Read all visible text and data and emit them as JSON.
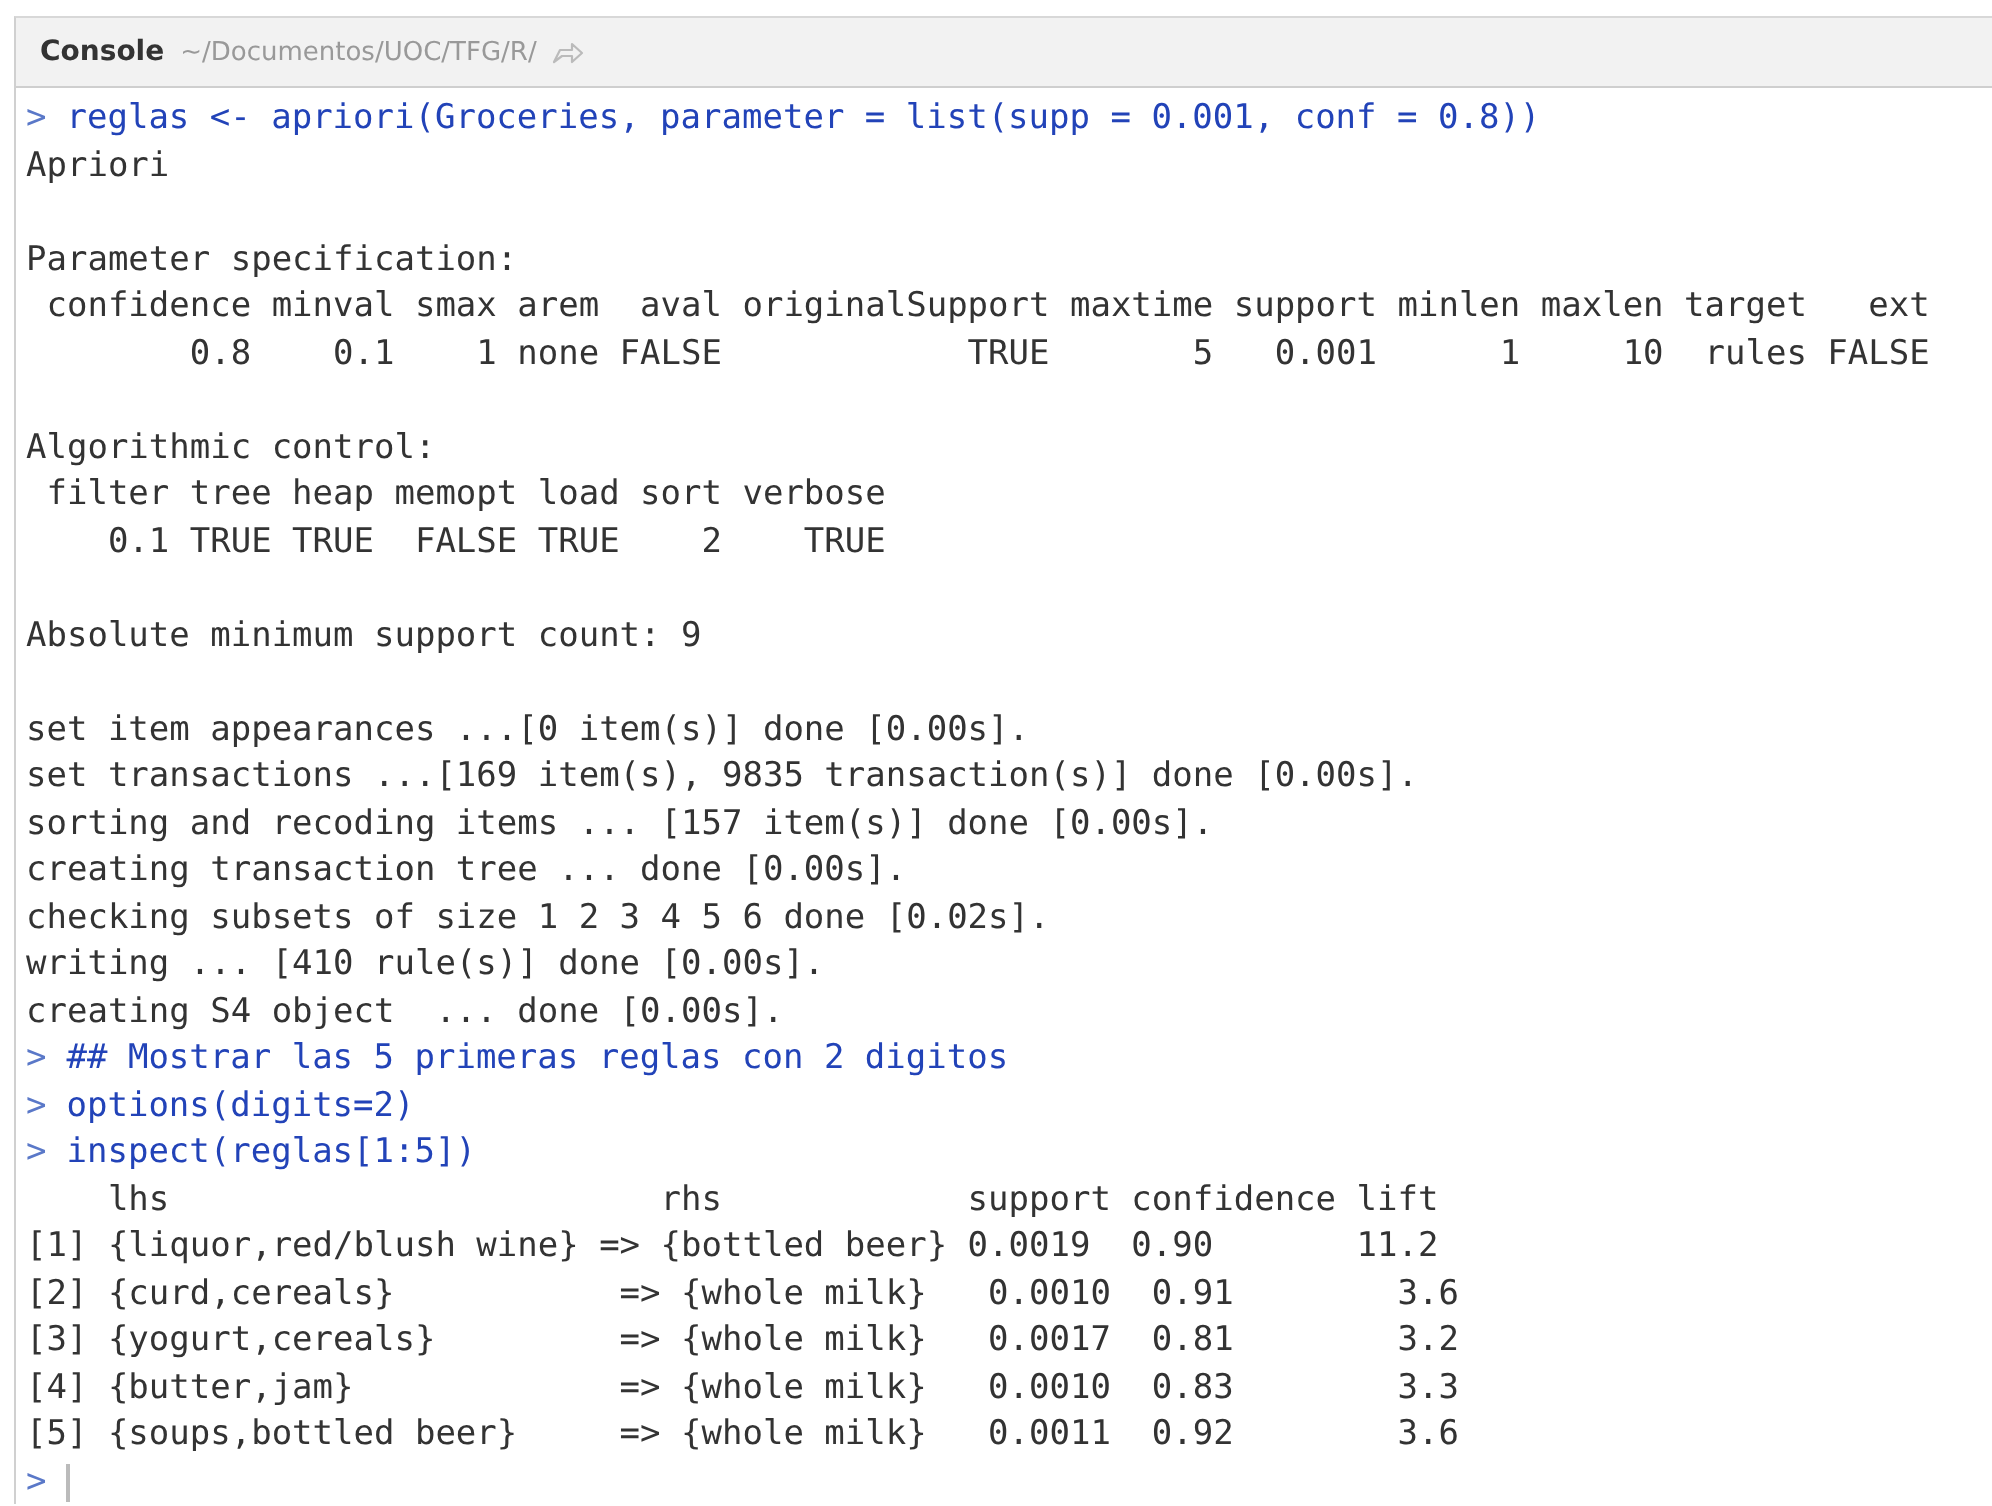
{
  "header": {
    "title": "Console",
    "path": "~/Documentos/UOC/TFG/R/"
  },
  "lines": [
    {
      "kind": "input",
      "prompt": ">",
      "text": "reglas <- apriori(Groceries, parameter = list(supp = 0.001, conf = 0.8))"
    },
    {
      "kind": "output",
      "text": "Apriori"
    },
    {
      "kind": "blank"
    },
    {
      "kind": "output",
      "text": "Parameter specification:"
    },
    {
      "kind": "output",
      "text": " confidence minval smax arem  aval originalSupport maxtime support minlen maxlen target   ext"
    },
    {
      "kind": "output",
      "text": "        0.8    0.1    1 none FALSE            TRUE       5   0.001      1     10  rules FALSE"
    },
    {
      "kind": "blank"
    },
    {
      "kind": "output",
      "text": "Algorithmic control:"
    },
    {
      "kind": "output",
      "text": " filter tree heap memopt load sort verbose"
    },
    {
      "kind": "output",
      "text": "    0.1 TRUE TRUE  FALSE TRUE    2    TRUE"
    },
    {
      "kind": "blank"
    },
    {
      "kind": "output",
      "text": "Absolute minimum support count: 9"
    },
    {
      "kind": "blank"
    },
    {
      "kind": "output",
      "text": "set item appearances ...[0 item(s)] done [0.00s]."
    },
    {
      "kind": "output",
      "text": "set transactions ...[169 item(s), 9835 transaction(s)] done [0.00s]."
    },
    {
      "kind": "output",
      "text": "sorting and recoding items ... [157 item(s)] done [0.00s]."
    },
    {
      "kind": "output",
      "text": "creating transaction tree ... done [0.00s]."
    },
    {
      "kind": "output",
      "text": "checking subsets of size 1 2 3 4 5 6 done [0.02s]."
    },
    {
      "kind": "output",
      "text": "writing ... [410 rule(s)] done [0.00s]."
    },
    {
      "kind": "output",
      "text": "creating S4 object  ... done [0.00s]."
    },
    {
      "kind": "input",
      "prompt": ">",
      "text": "## Mostrar las 5 primeras reglas con 2 digitos"
    },
    {
      "kind": "input",
      "prompt": ">",
      "text": "options(digits=2)"
    },
    {
      "kind": "input",
      "prompt": ">",
      "text": "inspect(reglas[1:5])"
    },
    {
      "kind": "output",
      "text": "    lhs                        rhs            support confidence lift"
    },
    {
      "kind": "output",
      "text": "[1] {liquor,red/blush wine} => {bottled beer} 0.0019  0.90       11.2"
    },
    {
      "kind": "output",
      "text": "[2] {curd,cereals}           => {whole milk}   0.0010  0.91        3.6"
    },
    {
      "kind": "output",
      "text": "[3] {yogurt,cereals}         => {whole milk}   0.0017  0.81        3.2"
    },
    {
      "kind": "output",
      "text": "[4] {butter,jam}             => {whole milk}   0.0010  0.83        3.3"
    },
    {
      "kind": "output",
      "text": "[5] {soups,bottled beer}     => {whole milk}   0.0011  0.92        3.6"
    },
    {
      "kind": "prompt",
      "prompt": ">"
    }
  ]
}
